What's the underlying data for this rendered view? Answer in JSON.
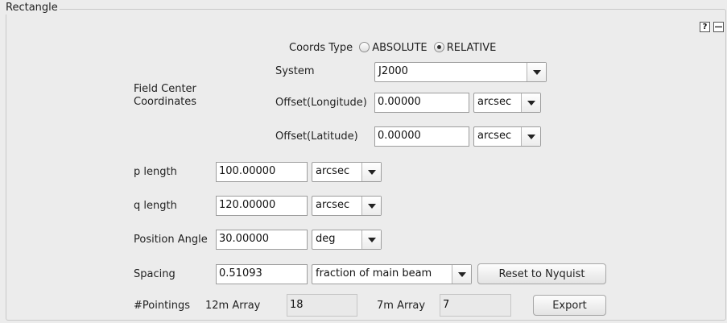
{
  "panel": {
    "title": "Rectangle",
    "help_label": "?",
    "collapse_label": "—"
  },
  "coords": {
    "label": "Coords Type",
    "options": [
      "ABSOLUTE",
      "RELATIVE"
    ],
    "selected": "RELATIVE"
  },
  "field_center": {
    "label_line1": "Field Center",
    "label_line2": "Coordinates",
    "system_label": "System",
    "system_value": "J2000",
    "offset_lon_label": "Offset(Longitude)",
    "offset_lon_value": "0.00000",
    "offset_lon_unit": "arcsec",
    "offset_lat_label": "Offset(Latitude)",
    "offset_lat_value": "0.00000",
    "offset_lat_unit": "arcsec"
  },
  "p_length": {
    "label": "p length",
    "value": "100.00000",
    "unit": "arcsec"
  },
  "q_length": {
    "label": "q length",
    "value": "120.00000",
    "unit": "arcsec"
  },
  "position_angle": {
    "label": "Position Angle",
    "value": "30.00000",
    "unit": "deg"
  },
  "spacing": {
    "label": "Spacing",
    "value": "0.51093",
    "unit": "fraction of main beam",
    "reset_label": "Reset to Nyquist"
  },
  "pointings": {
    "label": "#Pointings",
    "array12_label": "12m Array",
    "array12_value": "18",
    "array7_label": "7m Array",
    "array7_value": "7",
    "export_label": "Export"
  }
}
